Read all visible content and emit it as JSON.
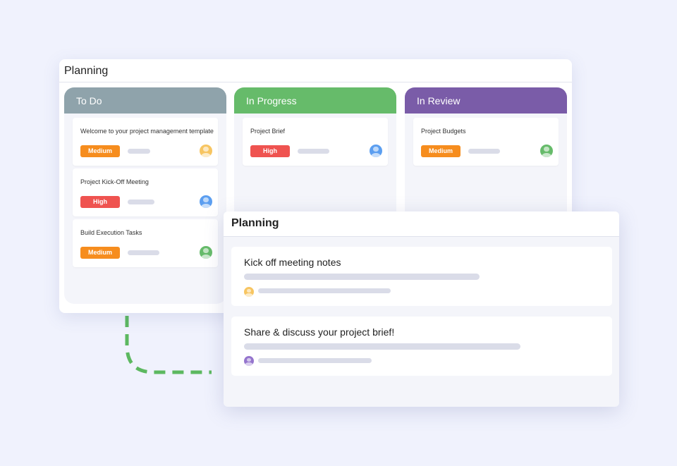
{
  "board": {
    "title": "Planning",
    "columns": [
      {
        "title": "To Do",
        "color": "#8fa3ab",
        "cards": [
          {
            "title": "Welcome to your project management template",
            "priority": "Medium",
            "priority_color": "#f68d1e",
            "avatar_color": "#f7c561"
          },
          {
            "title": "Project Kick-Off Meeting",
            "priority": "High",
            "priority_color": "#ef5350",
            "avatar_color": "#5b9ef0"
          },
          {
            "title": "Build Execution Tasks",
            "priority": "Medium",
            "priority_color": "#f68d1e",
            "avatar_color": "#66bb6a"
          }
        ]
      },
      {
        "title": "In Progress",
        "color": "#66bb6a",
        "cards": [
          {
            "title": "Project Brief",
            "priority": "High",
            "priority_color": "#ef5350",
            "avatar_color": "#5b9ef0"
          }
        ]
      },
      {
        "title": "In Review",
        "color": "#7a5ca8",
        "cards": [
          {
            "title": "Project Budgets",
            "priority": "Medium",
            "priority_color": "#f68d1e",
            "avatar_color": "#66bb6a"
          }
        ]
      }
    ]
  },
  "detail": {
    "title": "Planning",
    "notes": [
      {
        "title": "Kick off meeting notes",
        "avatar_color": "#f7c561"
      },
      {
        "title": "Share & discuss your project brief!",
        "avatar_color": "#9575cd"
      }
    ]
  },
  "connector_color": "#5cb860",
  "background_color": "#f0f2fd"
}
